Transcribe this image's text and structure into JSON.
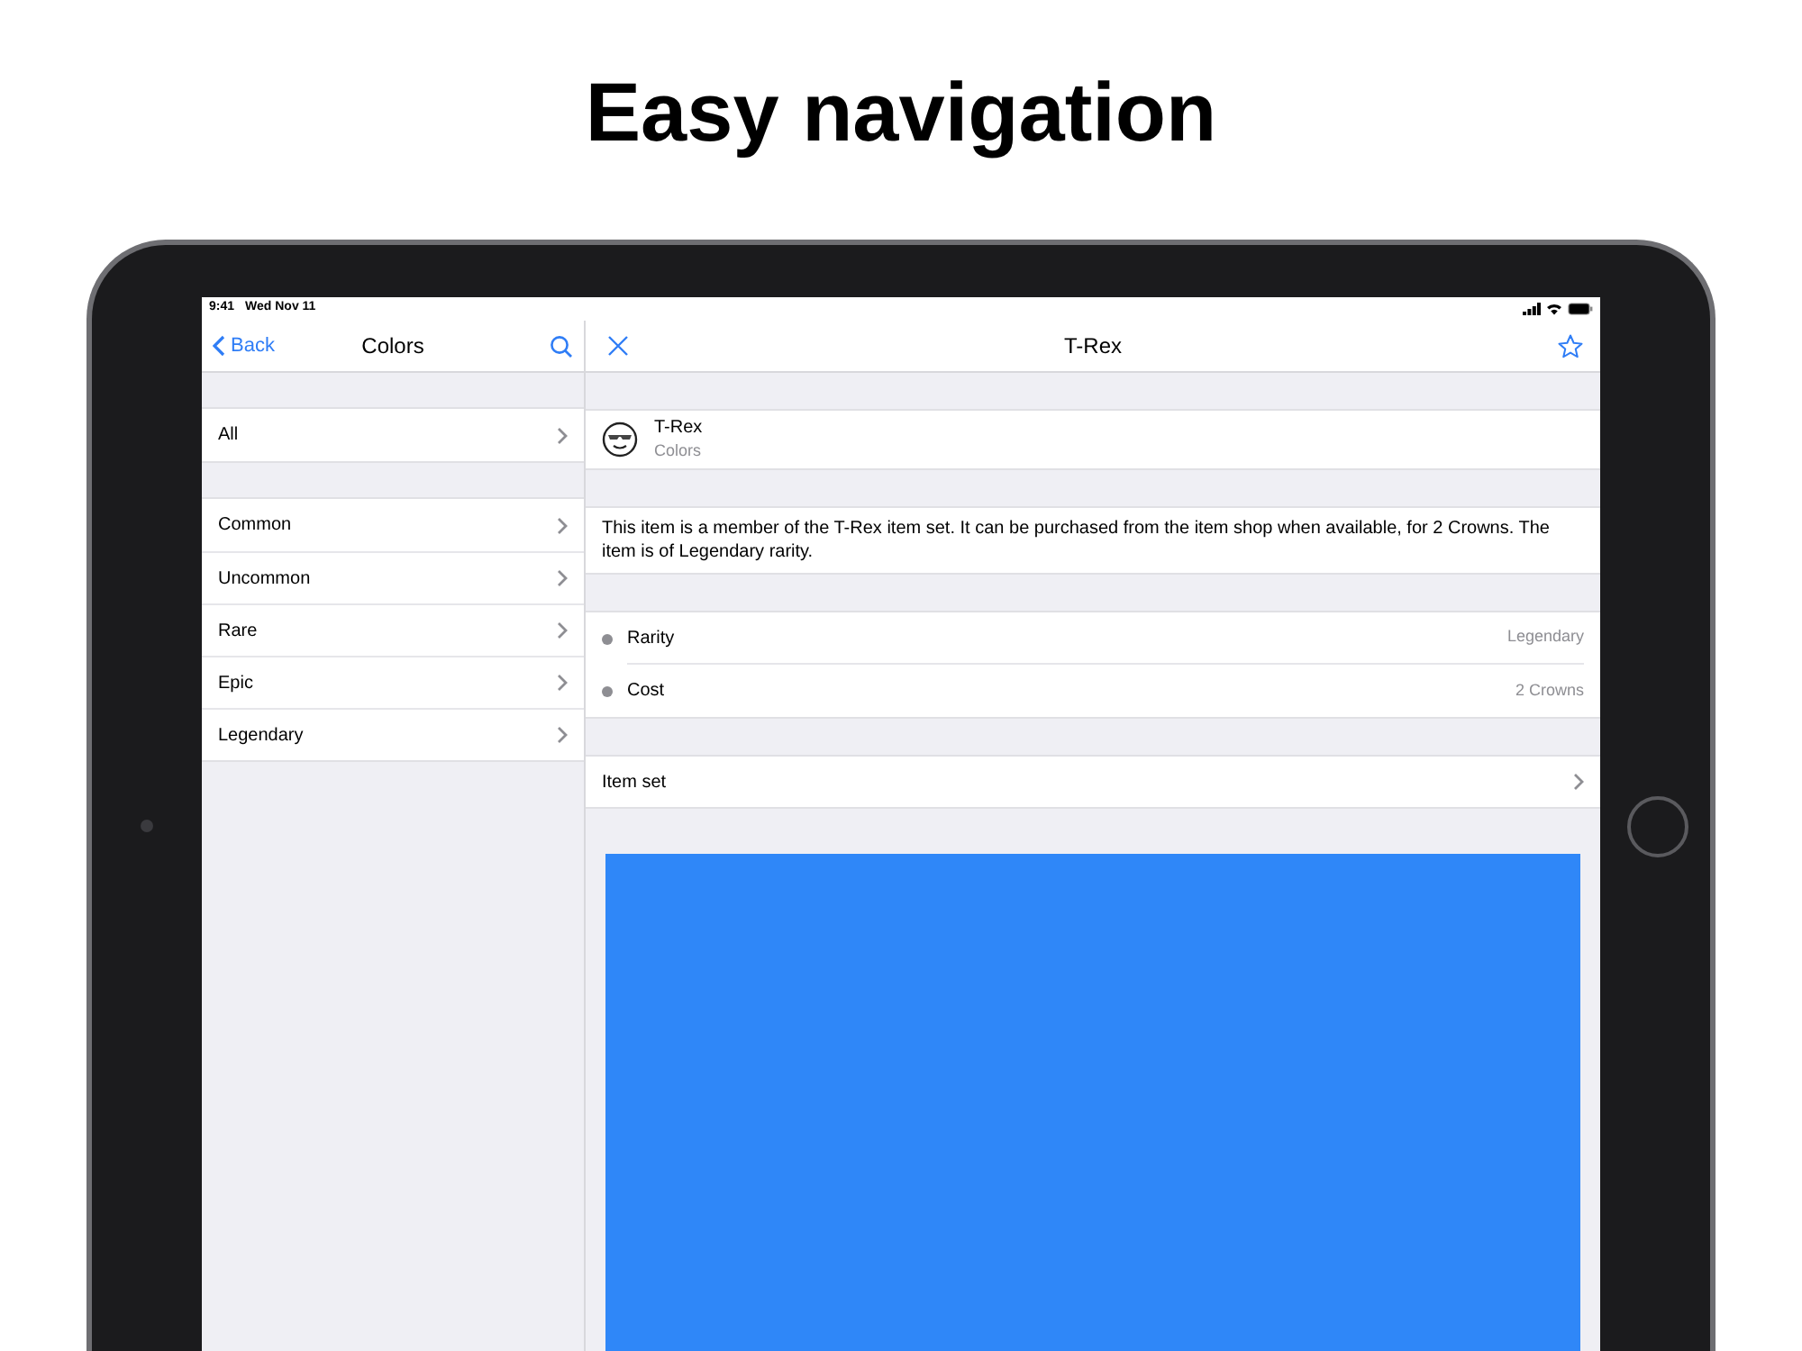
{
  "headline": "Easy navigation",
  "status_bar": {
    "time": "9:41",
    "date": "Wed Nov 11"
  },
  "sidebar": {
    "back": "Back",
    "title": "Colors",
    "sections": [
      [
        {
          "label": "All"
        }
      ],
      [
        {
          "label": "Common"
        },
        {
          "label": "Uncommon"
        },
        {
          "label": "Rare"
        },
        {
          "label": "Epic"
        },
        {
          "label": "Legendary"
        }
      ]
    ]
  },
  "detail": {
    "title": "T-Rex",
    "item": {
      "name": "T-Rex",
      "subtitle": "Colors"
    },
    "description": "This item is a member of the T-Rex item set. It can be purchased from the item shop when available, for 2 Crowns. The item is of Legendary rarity.",
    "properties": [
      {
        "label": "Rarity",
        "value": "Legendary"
      },
      {
        "label": "Cost",
        "value": "2 Crowns"
      }
    ],
    "links": [
      {
        "label": "Item set"
      }
    ]
  }
}
